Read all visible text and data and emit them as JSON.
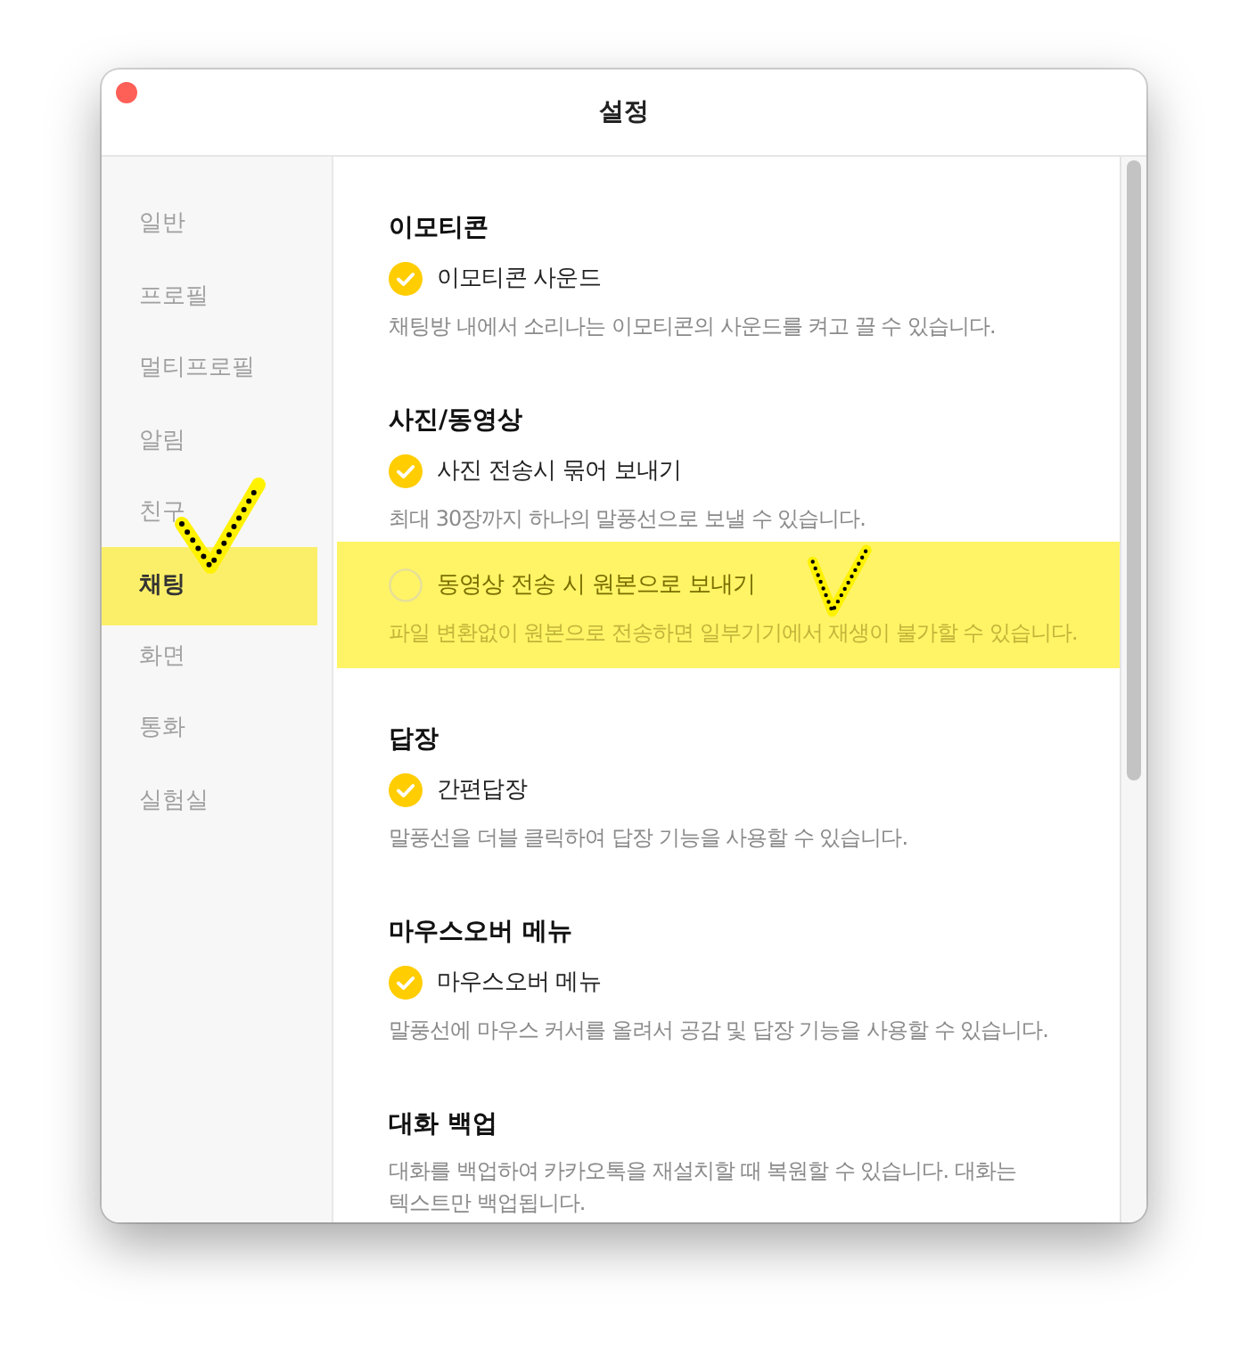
{
  "window": {
    "title": "설정"
  },
  "sidebar": {
    "items": [
      {
        "label": "일반",
        "selected": false
      },
      {
        "label": "프로필",
        "selected": false
      },
      {
        "label": "멀티프로필",
        "selected": false
      },
      {
        "label": "알림",
        "selected": false
      },
      {
        "label": "친구",
        "selected": false
      },
      {
        "label": "채팅",
        "selected": true
      },
      {
        "label": "화면",
        "selected": false
      },
      {
        "label": "통화",
        "selected": false
      },
      {
        "label": "실험실",
        "selected": false
      }
    ]
  },
  "sections": [
    {
      "title": "이모티콘",
      "options": [
        {
          "label": "이모티콘 사운드",
          "checked": true,
          "highlighted": false,
          "description": "채팅방 내에서 소리나는 이모티콘의 사운드를 켜고 끌 수 있습니다."
        }
      ]
    },
    {
      "title": "사진/동영상",
      "options": [
        {
          "label": "사진 전송시 묶어 보내기",
          "checked": true,
          "highlighted": false,
          "description": "최대 30장까지 하나의 말풍선으로 보낼 수 있습니다."
        },
        {
          "label": "동영상 전송 시 원본으로 보내기",
          "checked": false,
          "highlighted": true,
          "description": "파일 변환없이 원본으로 전송하면 일부기기에서 재생이 불가할 수 있습니다."
        }
      ]
    },
    {
      "title": "답장",
      "options": [
        {
          "label": "간편답장",
          "checked": true,
          "highlighted": false,
          "description": "말풍선을 더블 클릭하여 답장 기능을 사용할 수 있습니다."
        }
      ]
    },
    {
      "title": "마우스오버 메뉴",
      "options": [
        {
          "label": "마우스오버 메뉴",
          "checked": true,
          "highlighted": false,
          "description": "말풍선에 마우스 커서를 올려서 공감 및 답장 기능을 사용할 수 있습니다."
        }
      ]
    },
    {
      "title": "대화 백업",
      "description": "대화를 백업하여 카카오톡을 재설치할 때 복원할 수 있습니다. 대화는 텍스트만 백업됩니다."
    }
  ]
}
